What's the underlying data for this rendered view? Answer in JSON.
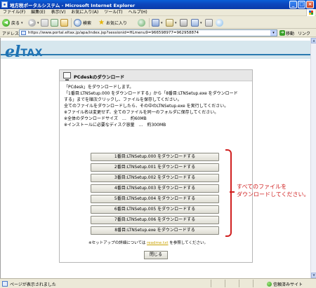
{
  "window": {
    "title": "地方税ポータルシステム - Microsoft Internet Explorer"
  },
  "menu": [
    "ファイル(F)",
    "編集(E)",
    "表示(V)",
    "お気に入り(A)",
    "ツール(T)",
    "ヘルプ(H)"
  ],
  "toolbar": {
    "back_label": "戻る",
    "search_label": "検索",
    "favorites_label": "お気に入り"
  },
  "address": {
    "label": "アドレス(D)",
    "url": "https://www.portal.eltax.jp/apa/index.jsp?sessionid=HLmenu9=966598977=962958874",
    "go_label": "移動",
    "links_label": "リンク"
  },
  "logo": {
    "e": "el",
    "tax": "TAX"
  },
  "dialog": {
    "title": "PCdeskのダウンロード",
    "lines": [
      "「PCdesk」をダウンロードします。",
      "「1番目:LTNSetup.000 をダウンロードする」から「8番目:LTNSetup.exe をダウンロード",
      "する」までを順次クリックし、ファイルを保存してください。",
      "全てのファイルをダウンロードしたら、その中のLTNSetup.exe を実行してください。",
      "※ファイル名は変更せず、全てのファイルを同一のフォルダに保存してください。",
      "※全体のダウンロードサイズ　…　約60MB",
      "※インストールに必要なディスク容量　…　約300MB"
    ],
    "buttons": [
      "1番目:LTNSetup.000 をダウンロードする",
      "2番目:LTNSetup.001 をダウンロードする",
      "3番目:LTNSetup.002 をダウンロードする",
      "4番目:LTNSetup.003 をダウンロードする",
      "5番目:LTNSetup.004 をダウンロードする",
      "6番目:LTNSetup.005 をダウンロードする",
      "7番目:LTNSetup.006 をダウンロードする",
      "8番目:LTNSetup.exe をダウンロードする"
    ],
    "annotation_line1": "すべてのファイルを",
    "annotation_line2": "ダウンロードしてください。",
    "note_prefix": "※セットアップの詳細については",
    "note_link": "readme.txt",
    "note_suffix": "を参照してください。",
    "close_label": "閉じる"
  },
  "status": {
    "text": "ページが表示されました",
    "zone": "信頼済みサイト"
  },
  "colors": {
    "accent_blue": "#1e73b5",
    "annotation_red": "#d02020"
  }
}
